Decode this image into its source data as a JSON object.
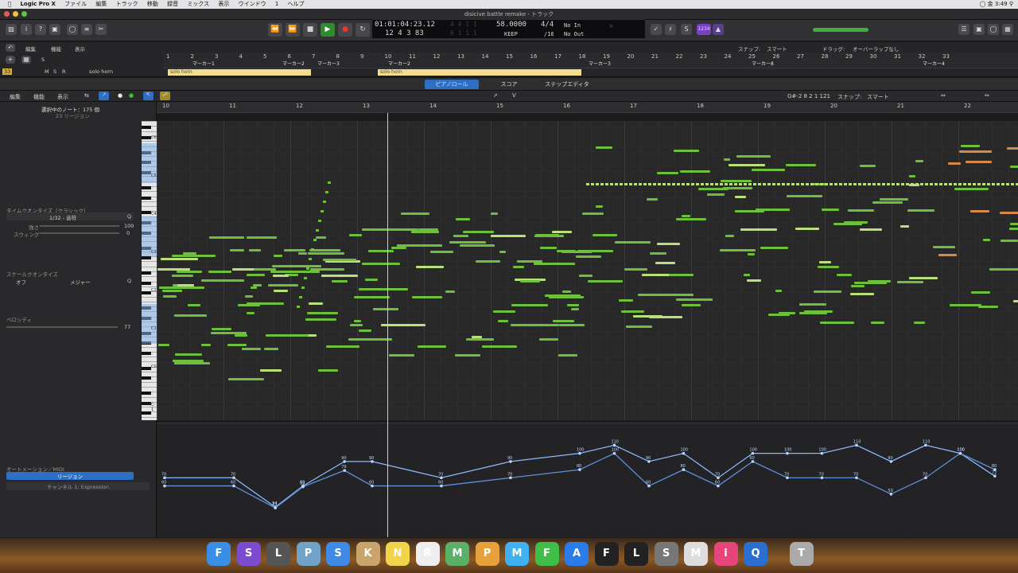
{
  "menubar": {
    "app": "Logic Pro X",
    "items": [
      "ファイル",
      "編集",
      "トラック",
      "移動",
      "録音",
      "ミックス",
      "表示",
      "ウインドウ",
      "1",
      "ヘルプ"
    ],
    "clock": "金 3:49"
  },
  "window": {
    "title": "disicive battle remake - トラック"
  },
  "lcd": {
    "position": "01:01:04:23.12",
    "bars": "12 4 3  83",
    "tempo": "58.0000",
    "keep": "KEEP",
    "signature": "4/4",
    "division": "/16",
    "in": "No In",
    "out": "No Out",
    "badge": "1234"
  },
  "tracks": {
    "number": "33",
    "m": "M",
    "s": "S",
    "r": "R",
    "name": "solo horn",
    "snap_label": "スナップ:",
    "snap_value": "スマート",
    "drag_label": "ドラッグ:",
    "drag_value": "オーバーラップなし"
  },
  "ruler_top": {
    "numbers": [
      "1",
      "2",
      "3",
      "4",
      "5",
      "6",
      "7",
      "8",
      "9",
      "10",
      "11",
      "12",
      "13",
      "14",
      "15",
      "16",
      "17",
      "18",
      "19",
      "20",
      "21",
      "22",
      "23",
      "24",
      "25",
      "26",
      "27",
      "28",
      "29",
      "30",
      "31",
      "32",
      "33"
    ],
    "markers": [
      "マーカー1",
      "マーカー2",
      "マーカー3",
      "マーカー2",
      "マーカー3",
      "マーカー8",
      "マーカー4"
    ]
  },
  "regions": [
    {
      "label": "solo horn"
    },
    {
      "label": "solo horn"
    }
  ],
  "tabs": {
    "piano_roll": "ピアノロール",
    "score": "スコア",
    "step": "ステップエディタ"
  },
  "pr_menu": {
    "edit": "編集",
    "function": "機能",
    "view": "表示"
  },
  "pr_right": {
    "position": "G#-2  8 2 1 121",
    "snap_label": "スナップ:",
    "snap_value": "スマート"
  },
  "inspector": {
    "selected": "選択中のノート：175 個",
    "regions": "23 リージョン",
    "tq_title": "タイムクオンタイズ（クラシック）",
    "tq_value": "1/32 - 音符",
    "strength_label": "強さ",
    "strength_value": "100",
    "swing_label": "スウィング",
    "swing_value": "0",
    "sq_title": "スケールクオンタイズ",
    "sq_off": "オフ",
    "sq_scale": "メジャー",
    "velocity_label": "ベロシティ",
    "velocity_value": "77",
    "automation_title": "オートメーション／MIDI",
    "automation_region": "リージョン",
    "automation_channel": "チャンネル 1: Expression",
    "q": "Q"
  },
  "ruler_pr": [
    "10",
    "11",
    "12",
    "13",
    "14",
    "15",
    "16",
    "17",
    "18",
    "19",
    "20",
    "21",
    "22"
  ],
  "keyboard_labels": [
    "C6",
    "C5",
    "C4",
    "C3",
    "C2",
    "C1",
    "C0",
    "C-1"
  ],
  "chart_data": {
    "type": "line",
    "title": "",
    "xlabel": "",
    "ylabel": "",
    "x": [
      10,
      11,
      11.6,
      12,
      12.6,
      13,
      14,
      15,
      16,
      16.5,
      17,
      17.5,
      18,
      18.5,
      19,
      19.5,
      20,
      20.5,
      21,
      21.5,
      22
    ],
    "series": [
      {
        "values": [
          70,
          70,
          34,
          60,
          90,
          90,
          70,
          90,
          100,
          110,
          90,
          100,
          70,
          100,
          100,
          100,
          110,
          90,
          110,
          100,
          72
        ]
      },
      {
        "values": [
          60,
          60,
          33,
          59,
          79,
          60,
          60,
          70,
          80,
          100,
          60,
          80,
          60,
          90,
          70,
          70,
          70,
          50,
          70,
          100,
          80
        ]
      }
    ],
    "annotations": [
      "79",
      "70",
      "53",
      "34",
      "40",
      "46",
      "90",
      "110",
      "100",
      "72"
    ],
    "ylim": [
      0,
      127
    ]
  },
  "dock": [
    "Finder",
    "Siri",
    "Launchpad",
    "Preview",
    "Safari",
    "Keynote",
    "Notes",
    "Reminders",
    "Maps",
    "Photos",
    "Messages",
    "FaceTime",
    "App Store",
    "Finale",
    "Logic",
    "System Preferences",
    "MuseScore",
    "iTunes",
    "QuickTime",
    "Trash"
  ]
}
